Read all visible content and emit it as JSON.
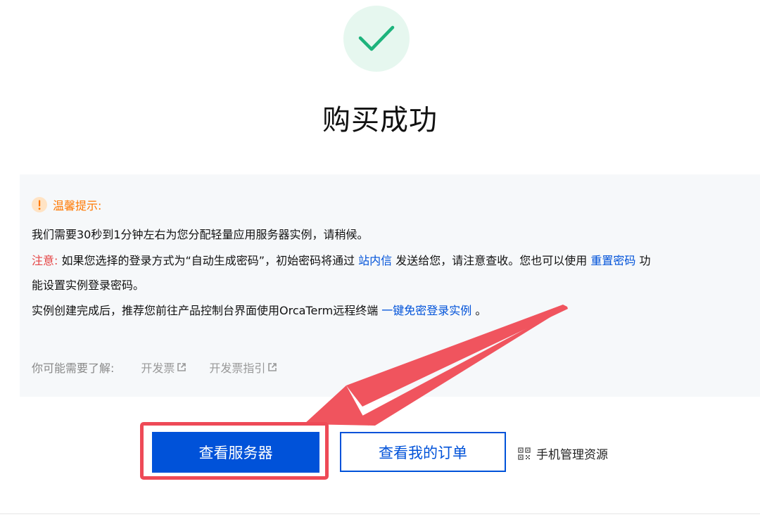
{
  "result": {
    "title": "购买成功",
    "icon": "check-icon",
    "accent_color": "#1db37c"
  },
  "notice": {
    "tip_icon": "exclamation-icon",
    "tip_title": "温馨提示:",
    "line1": "我们需要30秒到1分钟左右为您分配轻量应用服务器实例，请稍候。",
    "warning_label": "注意:",
    "line2_part1": " 如果您选择的登录方式为“自动生成密码”，初始密码将通过 ",
    "link_station_message": "站内信",
    "line2_part2": " 发送给您，请注意查收。您也可以使用 ",
    "link_reset_password": "重置密码",
    "line2_part3": " 功",
    "line3": "能设置实例登录密码。",
    "line4_part1": "实例创建完成后，推荐您前往产品控制台界面使用OrcaTerm远程终端 ",
    "link_passwordless_login": "一键免密登录实例",
    "line4_part2": " 。"
  },
  "learn_more": {
    "label": "你可能需要了解:",
    "links": [
      "开发票",
      "开发票指引"
    ],
    "link_icon": "external-link-icon"
  },
  "actions": {
    "primary_label": "查看服务器",
    "secondary_label": "查看我的订单",
    "mobile_label": "手机管理资源",
    "mobile_icon": "qr-code-icon",
    "primary_color": "#0052d9",
    "highlight_color": "#ee4a57"
  }
}
